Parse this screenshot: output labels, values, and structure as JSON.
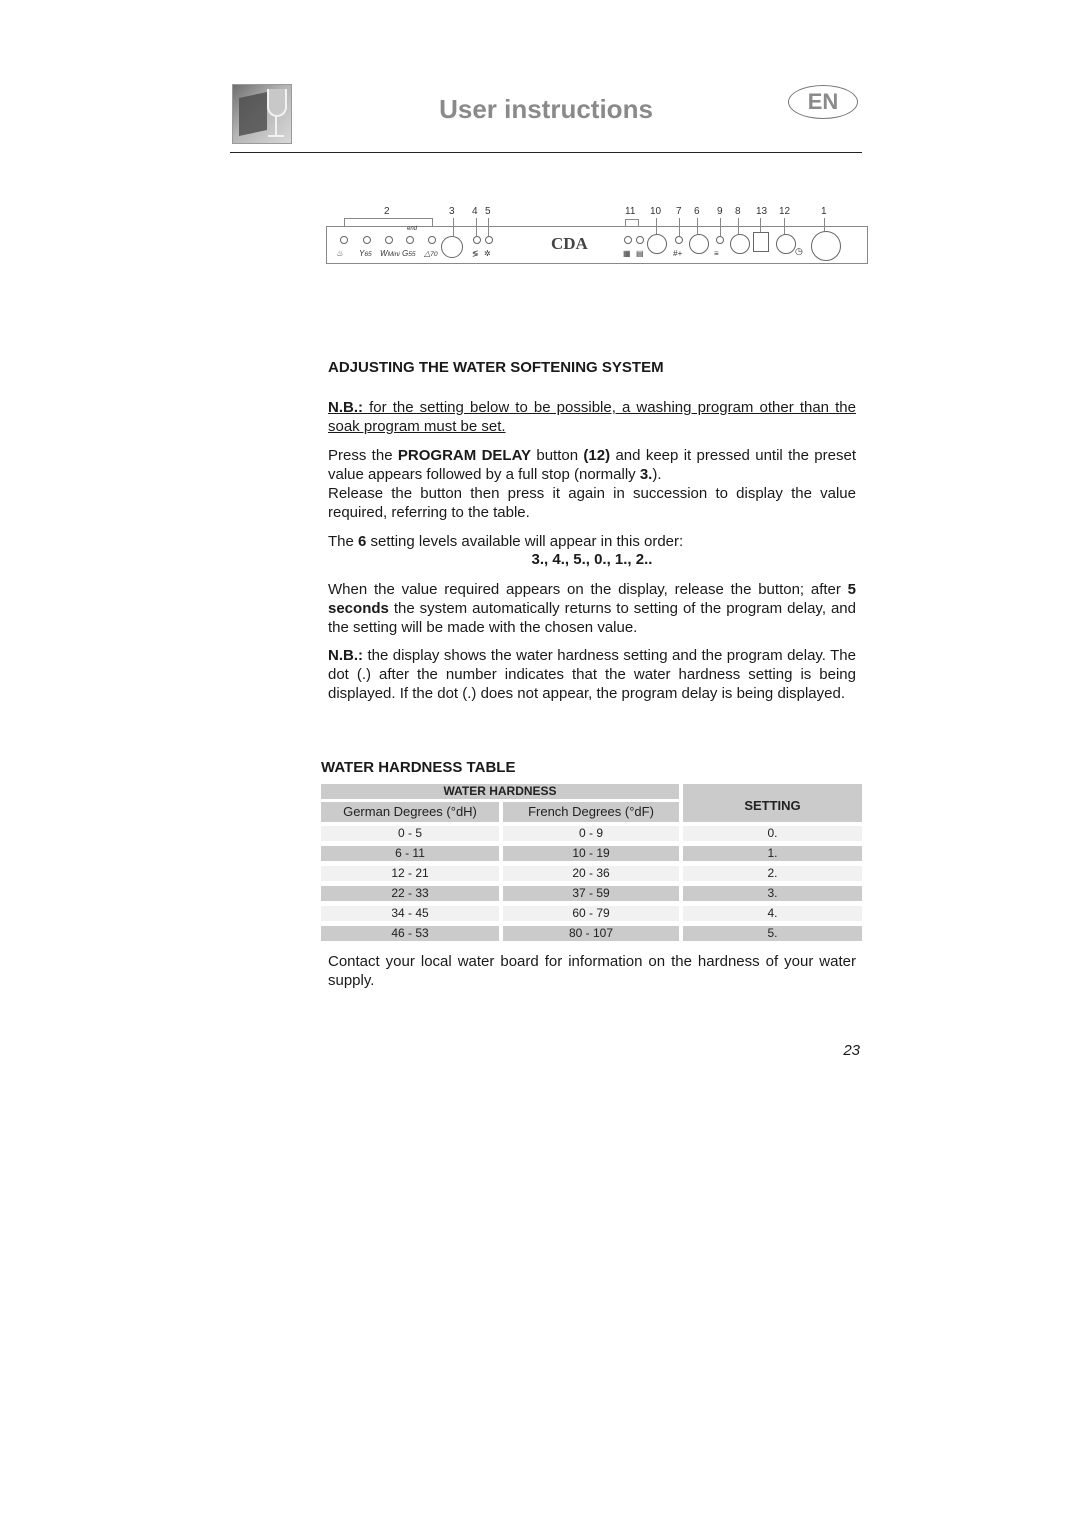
{
  "header": {
    "title": "User instructions",
    "language_badge": "EN"
  },
  "panel": {
    "numbers_left": [
      "2",
      "3",
      "4",
      "5"
    ],
    "numbers_right": [
      "11",
      "10",
      "7",
      "6",
      "9",
      "8",
      "13",
      "12",
      "1"
    ],
    "brand": "CDA",
    "program_symbols": [
      "soak",
      "65",
      "Mini",
      "55",
      "70"
    ],
    "end_label": "end"
  },
  "section": {
    "heading": "ADJUSTING THE WATER SOFTENING SYSTEM",
    "nb1_label": "N.B.:",
    "nb1_text": " for the setting below to be possible, a washing program other than the soak program must be set.",
    "p1_a": "Press the ",
    "p1_b": "PROGRAM DELAY",
    "p1_c": " button ",
    "p1_d": "(12)",
    "p1_e": " and keep it pressed until the preset value appears followed by a full stop (normally ",
    "p1_f": "3.",
    "p1_g": ").",
    "p2": "Release the button then press it again in succession to display the value required, referring to the table.",
    "p3_a": "The ",
    "p3_b": "6",
    "p3_c": " setting levels available will appear in this order:",
    "order": "3., 4., 5., 0., 1., 2..",
    "p4_a": "When the value required appears on the display, release the button; after ",
    "p4_b": "5 seconds",
    "p4_c": " the system automatically returns to setting of the program delay, and the setting will be made with the chosen value.",
    "nb2_label": "N.B.:",
    "nb2_text": " the display shows the water hardness setting and the program delay. The dot (.) after the number indicates that the water hardness setting is being displayed. If the dot (.) does not appear, the program delay is being displayed."
  },
  "table": {
    "title": "WATER HARDNESS TABLE",
    "group_header": "WATER HARDNESS",
    "col_german": "German Degrees (°dH)",
    "col_french": "French Degrees (°dF)",
    "col_setting": "SETTING",
    "rows": [
      {
        "german": "0 - 5",
        "french": "0 - 9",
        "setting": "0."
      },
      {
        "german": "6 - 11",
        "french": "10 - 19",
        "setting": "1."
      },
      {
        "german": "12 - 21",
        "french": "20 - 36",
        "setting": "2."
      },
      {
        "german": "22 - 33",
        "french": "37 - 59",
        "setting": "3."
      },
      {
        "german": "34 - 45",
        "french": "60 - 79",
        "setting": "4."
      },
      {
        "german": "46 - 53",
        "french": "80 - 107",
        "setting": "5."
      }
    ]
  },
  "footer_text": "Contact your local water board for information on the hardness of your water supply.",
  "page_number": "23"
}
